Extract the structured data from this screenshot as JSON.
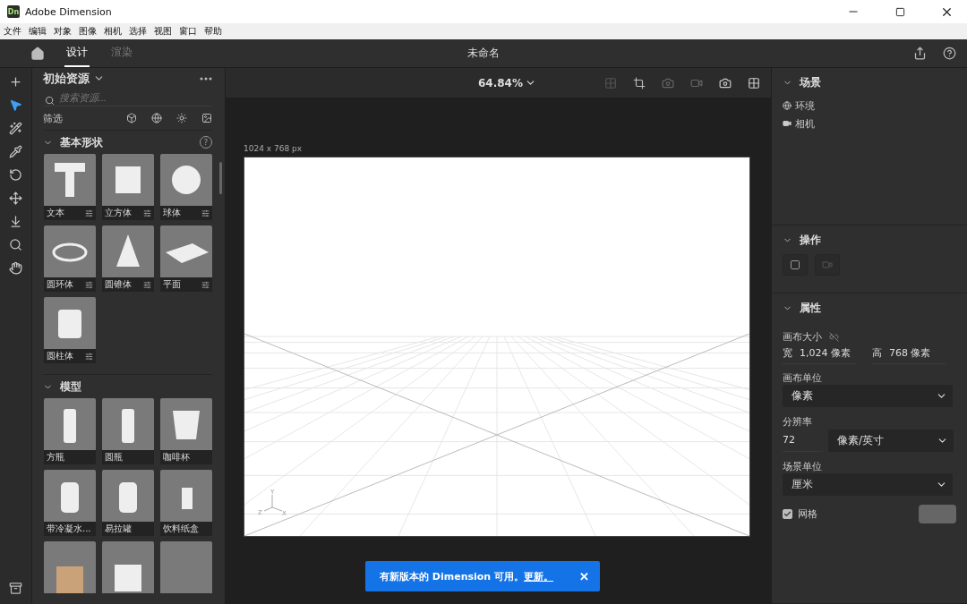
{
  "window": {
    "title": "Adobe Dimension",
    "logo": "Dn"
  },
  "menu": [
    "文件",
    "编辑",
    "对象",
    "图像",
    "相机",
    "选择",
    "视图",
    "窗口",
    "帮助"
  ],
  "app_bar": {
    "tabs": [
      {
        "label": "设计",
        "selected": true
      },
      {
        "label": "渲染",
        "selected": false
      }
    ],
    "document_title": "未命名"
  },
  "tools": [
    {
      "kind": "add",
      "selected": false
    },
    {
      "kind": "select",
      "selected": true
    },
    {
      "kind": "magic",
      "selected": false
    },
    {
      "kind": "sampler",
      "selected": false
    },
    {
      "kind": "orbit",
      "selected": false
    },
    {
      "kind": "move",
      "selected": false
    },
    {
      "kind": "drop",
      "selected": false
    },
    {
      "kind": "zoom",
      "selected": false
    },
    {
      "kind": "hand",
      "selected": false
    }
  ],
  "assets": {
    "title": "初始资源",
    "search": {
      "placeholder": "搜索资源..."
    },
    "filter_label": "筛选",
    "sections": [
      {
        "title": "基本形状",
        "expanded": true,
        "help": "?",
        "items": [
          {
            "label": "文本",
            "kind": "text",
            "adjustable": true
          },
          {
            "label": "立方体",
            "kind": "cube",
            "adjustable": true
          },
          {
            "label": "球体",
            "kind": "sphere",
            "adjustable": true
          },
          {
            "label": "圆环体",
            "kind": "torus",
            "adjustable": true
          },
          {
            "label": "圆锥体",
            "kind": "cone",
            "adjustable": true
          },
          {
            "label": "平面",
            "kind": "plane",
            "adjustable": true
          },
          {
            "label": "圆柱体",
            "kind": "cylinder",
            "adjustable": true
          }
        ]
      },
      {
        "title": "模型",
        "expanded": true,
        "items": [
          {
            "label": "方瓶",
            "kind": "bottle",
            "adjustable": false
          },
          {
            "label": "圆瓶",
            "kind": "bottle",
            "adjustable": false
          },
          {
            "label": "咖啡杯",
            "kind": "cup",
            "adjustable": false
          },
          {
            "label": "带冷凝水...",
            "kind": "can",
            "adjustable": false
          },
          {
            "label": "易拉罐",
            "kind": "can",
            "adjustable": false
          },
          {
            "label": "饮料纸盒",
            "kind": "carton",
            "adjustable": false
          },
          {
            "kind": "box"
          },
          {
            "kind": "pouch"
          },
          {
            "kind": "blank"
          }
        ]
      }
    ]
  },
  "viewport": {
    "zoom": "64.84%",
    "canvas_size_label": "1024 x 768 px",
    "axis_labels": [
      "Y",
      "Z",
      "X"
    ]
  },
  "toast": {
    "message": "有新版本的 Dimension 可用。",
    "link": "更新。",
    "close": "✕"
  },
  "scene": {
    "title": "场景",
    "items": [
      {
        "kind": "environment",
        "label": "环境"
      },
      {
        "kind": "camera",
        "label": "相机"
      }
    ]
  },
  "actions": {
    "title": "操作"
  },
  "properties": {
    "title": "属性",
    "canvas_size_label": "画布大小",
    "width_label": "宽",
    "width": "1,024 像素",
    "height_label": "高",
    "height": "768 像素",
    "canvas_unit_label": "画布单位",
    "canvas_unit": "像素",
    "resolution_label": "分辨率",
    "resolution": "72",
    "resolution_unit": "像素/英寸",
    "scene_unit_label": "场景单位",
    "scene_unit": "厘米",
    "grid": {
      "label": "网格",
      "checked": true
    }
  }
}
